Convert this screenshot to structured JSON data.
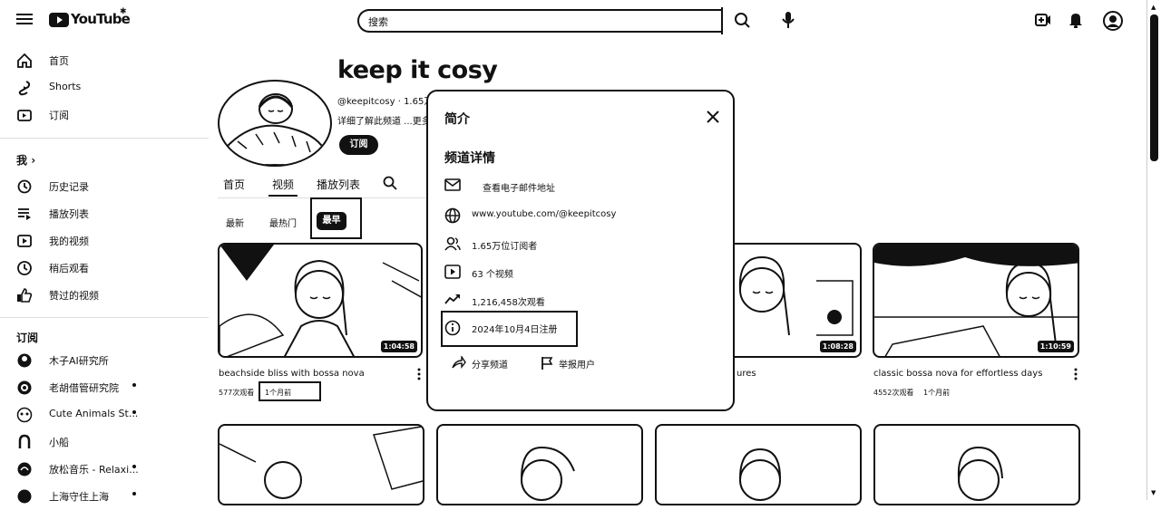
{
  "header": {
    "logo_text": "YouTube",
    "search_placeholder": "搜索"
  },
  "sidebar": {
    "main": [
      {
        "label": "首页",
        "icon": "home-icon"
      },
      {
        "label": "Shorts",
        "icon": "shorts-icon"
      },
      {
        "label": "订阅",
        "icon": "subscriptions-icon"
      }
    ],
    "me_header": "我",
    "me_items": [
      {
        "label": "历史记录",
        "icon": "history-icon"
      },
      {
        "label": "播放列表",
        "icon": "playlists-icon"
      },
      {
        "label": "我的视频",
        "icon": "my-videos-icon"
      },
      {
        "label": "稍后观看",
        "icon": "watch-later-icon"
      },
      {
        "label": "赞过的视频",
        "icon": "liked-icon"
      }
    ],
    "subs_header": "订阅",
    "subscriptions": [
      {
        "label": "木子AI研究所"
      },
      {
        "label": "老胡借管研究院"
      },
      {
        "label": "Cute Animals St..."
      },
      {
        "label": "小船"
      },
      {
        "label": "放松音乐 - Relaxi..."
      },
      {
        "label": "上海守住上海"
      }
    ]
  },
  "channel": {
    "name": "keep it cosy",
    "handle_stats": "@keepitcosy · 1.65万",
    "description": "详细了解此频道 ...更多",
    "subscribe_label": "订阅",
    "tabs": [
      "首页",
      "视频",
      "播放列表"
    ],
    "chips": [
      "最新",
      "最热门",
      "最早"
    ]
  },
  "videos": [
    {
      "title": "beachside bliss with bossa nova",
      "views": "577次观看",
      "age": "1个月前",
      "duration": "1:04:58"
    },
    {
      "title": "ures",
      "views": "",
      "age": "",
      "duration": "1:08:28"
    },
    {
      "title": "classic bossa nova for effortless days",
      "views": "4552次观看",
      "age": "1个月前",
      "duration": "1:10:59"
    }
  ],
  "dialog": {
    "title": "简介",
    "section": "频道详情",
    "rows": [
      {
        "icon": "mail-icon",
        "text": "查看电子邮件地址"
      },
      {
        "icon": "globe-icon",
        "text": "www.youtube.com/@keepitcosy"
      },
      {
        "icon": "people-icon",
        "text": "1.65万位订阅者"
      },
      {
        "icon": "video-icon",
        "text": "63 个视频"
      },
      {
        "icon": "trend-icon",
        "text": "1,216,458次观看"
      },
      {
        "icon": "info-icon",
        "text": "2024年10月4日注册"
      }
    ],
    "share_label": "分享频道",
    "report_label": "举报用户"
  }
}
